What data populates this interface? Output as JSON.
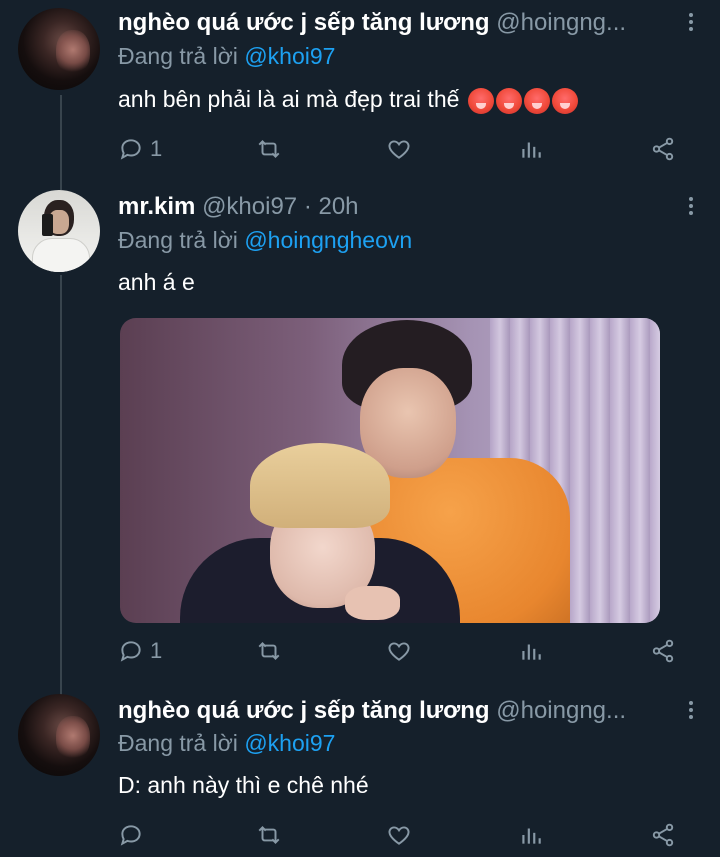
{
  "tweets": [
    {
      "name": "nghèo quá ước j sếp tăng lương",
      "handle": "@hoingng...",
      "reply_label": "Đang trả lời",
      "reply_to": "@khoi97",
      "text": "anh bên phải là ai mà đẹp trai thế",
      "emojis": [
        "hot-face-emoji",
        "hot-face-emoji",
        "hot-face-emoji",
        "hot-face-emoji"
      ],
      "reply_count": "1"
    },
    {
      "name": "mr.kim",
      "handle": "@khoi97 · 20h",
      "reply_label": "Đang trả lời",
      "reply_to": "@hoingngheovn",
      "text": "anh á e",
      "has_media": true,
      "reply_count": "1"
    },
    {
      "name": "nghèo quá ước j sếp tăng lương",
      "handle": "@hoingng...",
      "reply_label": "Đang trả lời",
      "reply_to": "@khoi97",
      "text": "D: anh này thì e chê nhé",
      "reply_count": ""
    }
  ],
  "icons": {
    "reply": "reply-icon",
    "retweet": "retweet-icon",
    "like": "heart-icon",
    "analytics": "analytics-icon",
    "share": "share-icon",
    "more": "more-icon"
  },
  "colors": {
    "background": "#15202b",
    "secondary_text": "#8899a6",
    "link": "#1da1f2",
    "thread_line": "#38444d"
  }
}
